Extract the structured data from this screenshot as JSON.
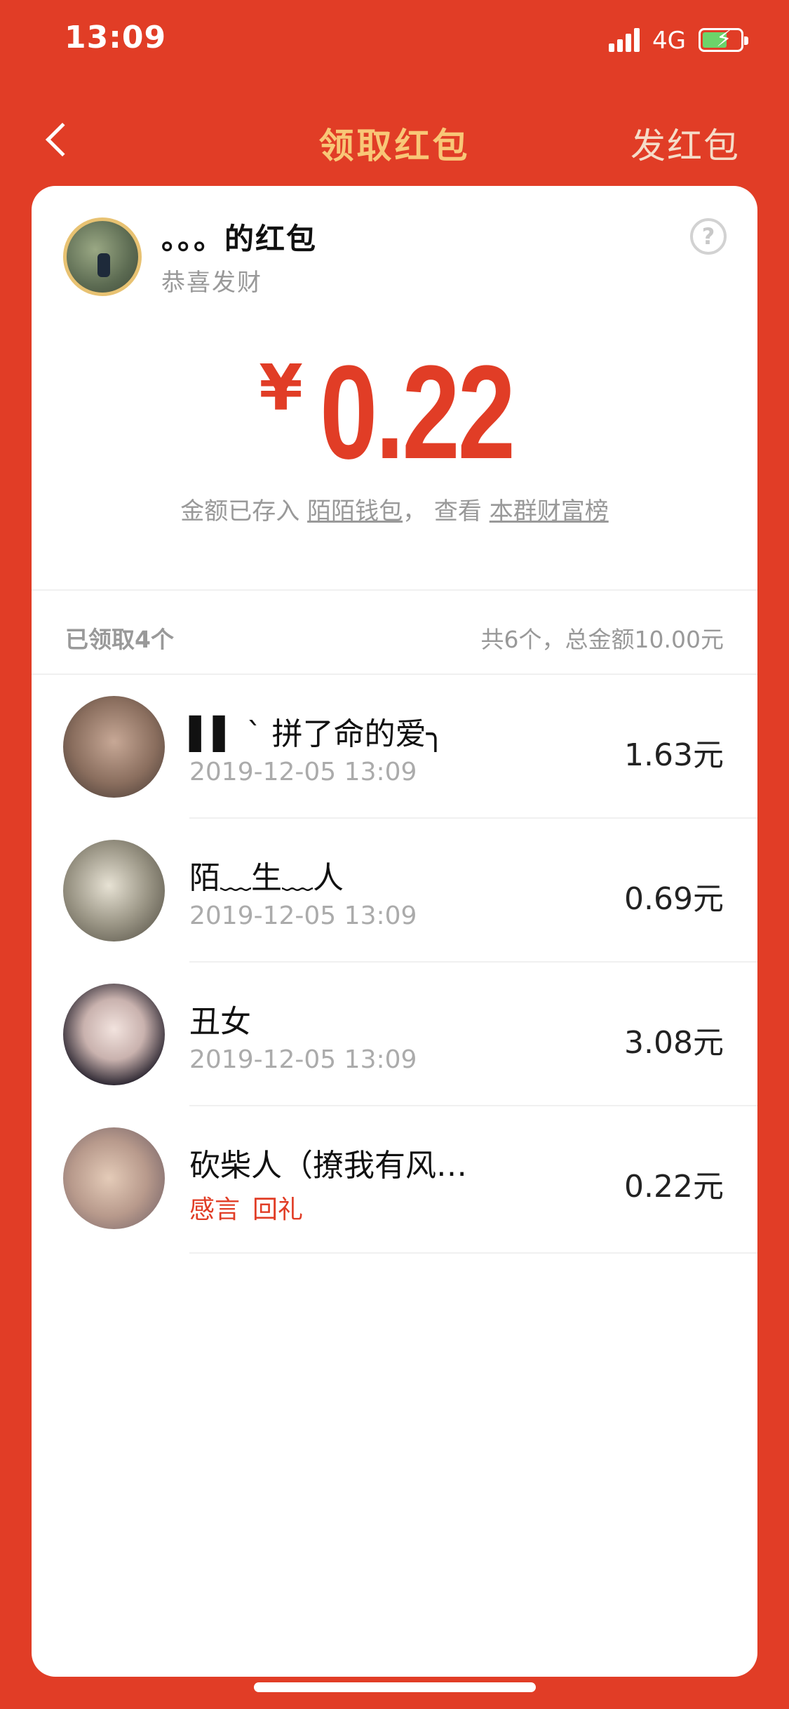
{
  "status_bar": {
    "time": "13:09",
    "network": "4G"
  },
  "nav": {
    "title": "领取红包",
    "send_label": "发红包"
  },
  "packet": {
    "sender_title": "。。。的红包",
    "message": "恭喜发财",
    "currency": "¥",
    "amount": "0.22",
    "deposit_prefix": "金额已存入",
    "wallet_link": "陌陌钱包",
    "deposit_mid": "，  查看",
    "rank_link": "本群财富榜"
  },
  "summary": {
    "received": "已领取4个",
    "total": "共6个，总金额10.00元"
  },
  "receivers": [
    {
      "name": "▌▌ ˋ 拼了命的爱╮",
      "time": "2019-12-05 13:09",
      "amount": "1.63元"
    },
    {
      "name": "陌﹏生﹏人",
      "time": "2019-12-05 13:09",
      "amount": "0.69元"
    },
    {
      "name": "丑女",
      "time": "2019-12-05 13:09",
      "amount": "3.08元"
    },
    {
      "name": "砍柴人（撩我有风…",
      "thanks_label": "感言",
      "return_gift_label": "回礼",
      "amount": "0.22元"
    }
  ]
}
